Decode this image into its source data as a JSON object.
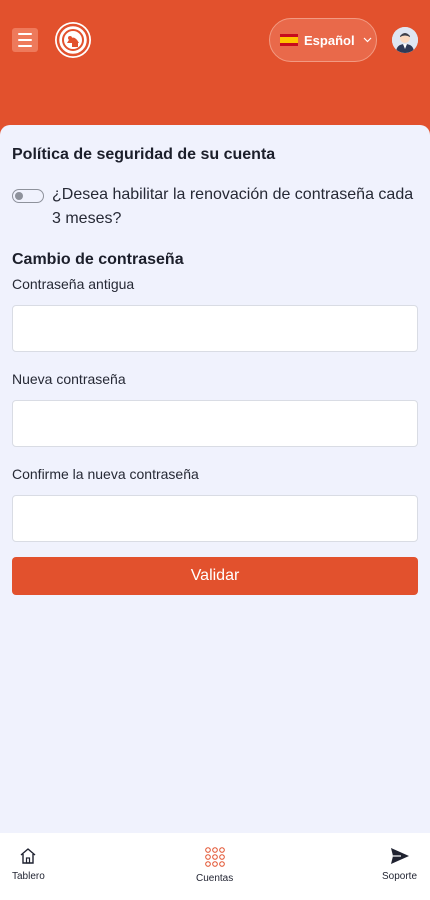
{
  "header": {
    "language_label": "Español",
    "language_flag": "es-flag"
  },
  "security_policy": {
    "title": "Política de seguridad de su cuenta",
    "toggle_text": "¿Desea habilitar la renovación de contraseña cada 3 meses?",
    "toggle_on": false
  },
  "password_change": {
    "title": "Cambio de contraseña",
    "old_password_label": "Contraseña antigua",
    "old_password_value": "",
    "new_password_label": "Nueva contraseña",
    "new_password_value": "",
    "confirm_password_label": "Confirme la nueva contraseña",
    "confirm_password_value": "",
    "submit_label": "Validar"
  },
  "bottom_nav": {
    "items": [
      {
        "label": "Tablero",
        "icon": "home-icon"
      },
      {
        "label": "Cuentas",
        "icon": "grid-dots-icon"
      },
      {
        "label": "Soporte",
        "icon": "send-icon"
      }
    ]
  },
  "colors": {
    "brand": "#e2512d",
    "background": "#f0f2fd",
    "nav_background": "#ffffff"
  }
}
